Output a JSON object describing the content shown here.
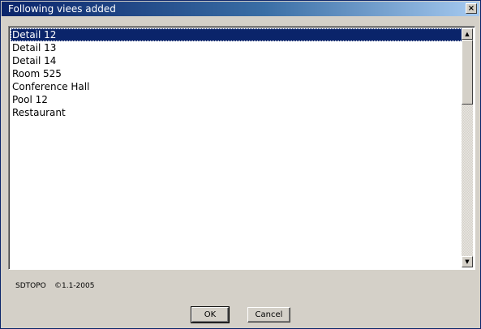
{
  "window": {
    "title": "Following viees added",
    "close_label": "×"
  },
  "list": {
    "items": [
      {
        "label": "Detail 12",
        "selected": true
      },
      {
        "label": "Detail 13",
        "selected": false
      },
      {
        "label": "Detail 14",
        "selected": false
      },
      {
        "label": "Room 525",
        "selected": false
      },
      {
        "label": "Conference Hall",
        "selected": false
      },
      {
        "label": "Pool 12",
        "selected": false
      },
      {
        "label": "Restaurant",
        "selected": false
      }
    ]
  },
  "scrollbar": {
    "up_arrow": "▲",
    "down_arrow": "▼"
  },
  "footer": {
    "app_name": "SDTOPO",
    "version": "©1.1-2005"
  },
  "buttons": {
    "ok_label": "OK",
    "cancel_label": "Cancel"
  },
  "colors": {
    "titlebar_start": "#0a246a",
    "titlebar_end": "#a6caf0",
    "selection": "#0a246a",
    "dialog_face": "#d4d0c8"
  }
}
